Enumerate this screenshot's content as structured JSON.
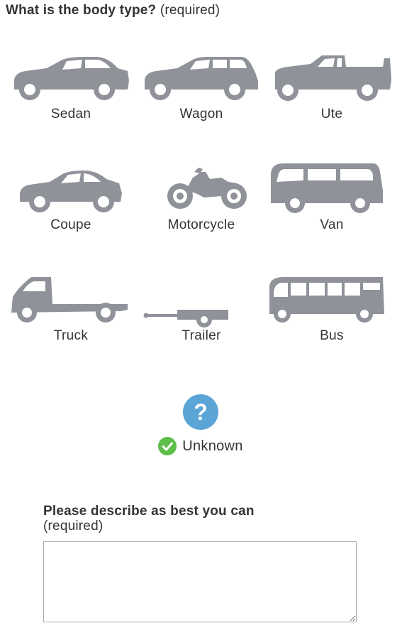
{
  "question": {
    "title": "What is the body type?",
    "note": "(required)"
  },
  "body_types": [
    {
      "label": "Sedan",
      "icon": "sedan-icon"
    },
    {
      "label": "Wagon",
      "icon": "wagon-icon"
    },
    {
      "label": "Ute",
      "icon": "ute-icon"
    },
    {
      "label": "Coupe",
      "icon": "coupe-icon"
    },
    {
      "label": "Motorcycle",
      "icon": "motorcycle-icon"
    },
    {
      "label": "Van",
      "icon": "van-icon"
    },
    {
      "label": "Truck",
      "icon": "truck-icon"
    },
    {
      "label": "Trailer",
      "icon": "trailer-icon"
    },
    {
      "label": "Bus",
      "icon": "bus-icon"
    }
  ],
  "unknown_option": {
    "label": "Unknown",
    "selected": true,
    "icon": "question-mark-icon"
  },
  "describe": {
    "title": "Please describe as best you can",
    "note": "(required)",
    "value": ""
  },
  "colors": {
    "vehicle_icon": "#8f9299",
    "question_icon": "#5aa4d6",
    "check": "#5cbf4a",
    "text": "#333333"
  }
}
